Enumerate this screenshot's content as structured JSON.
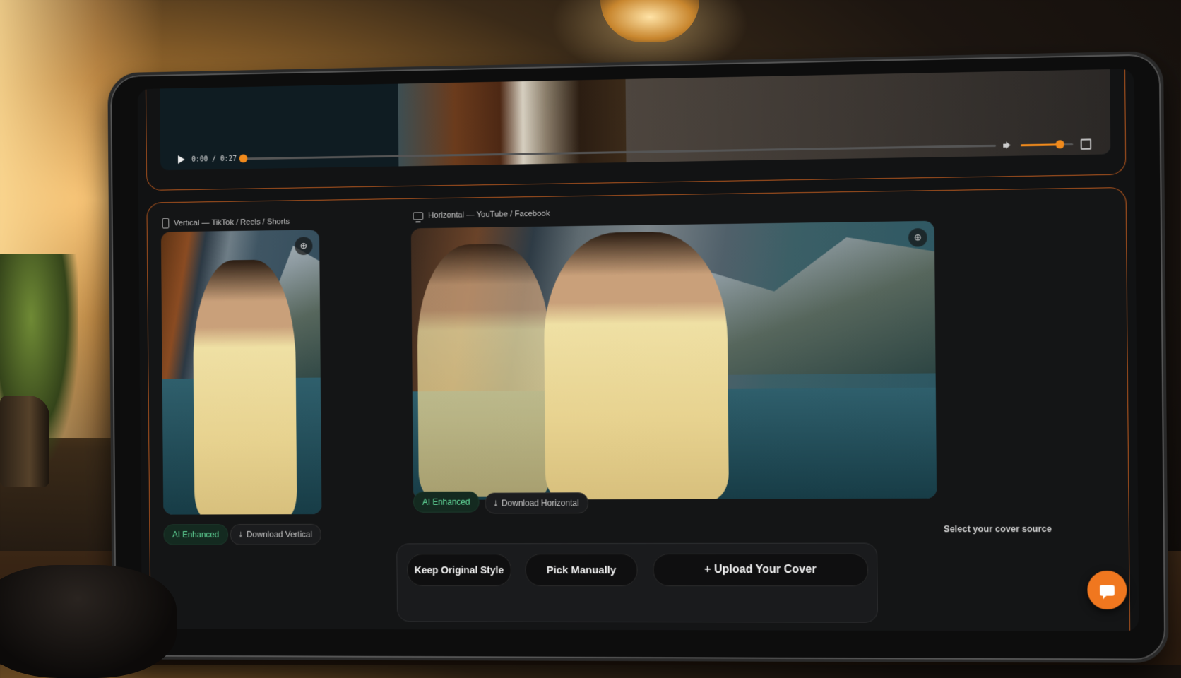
{
  "video": {
    "time_display": "0:00 / 0:27",
    "progress_fraction": 0.0,
    "volume_fraction": 0.75
  },
  "vertical": {
    "label": "Vertical — TikTok / Reels / Shorts",
    "badge": "AI Enhanced",
    "download_label": "Download Vertical"
  },
  "horizontal": {
    "label": "Horizontal — YouTube / Facebook",
    "badge": "AI Enhanced",
    "download_label": "Download Horizontal"
  },
  "cover_source": {
    "prompt": "Select your cover source",
    "buttons": [
      {
        "label": "Keep Original Style"
      },
      {
        "label": "Pick Manually"
      },
      {
        "label": "+ Upload Your Cover"
      }
    ]
  },
  "icons": {
    "play": "play-icon",
    "volume": "volume-icon",
    "fullscreen": "fullscreen-icon",
    "zoom": "zoom-icon",
    "download": "download-icon",
    "chat": "chat-icon"
  },
  "colors": {
    "accent": "#f0771f",
    "panel_border": "#b2561e",
    "ai_badge_text": "#66e2a0"
  }
}
